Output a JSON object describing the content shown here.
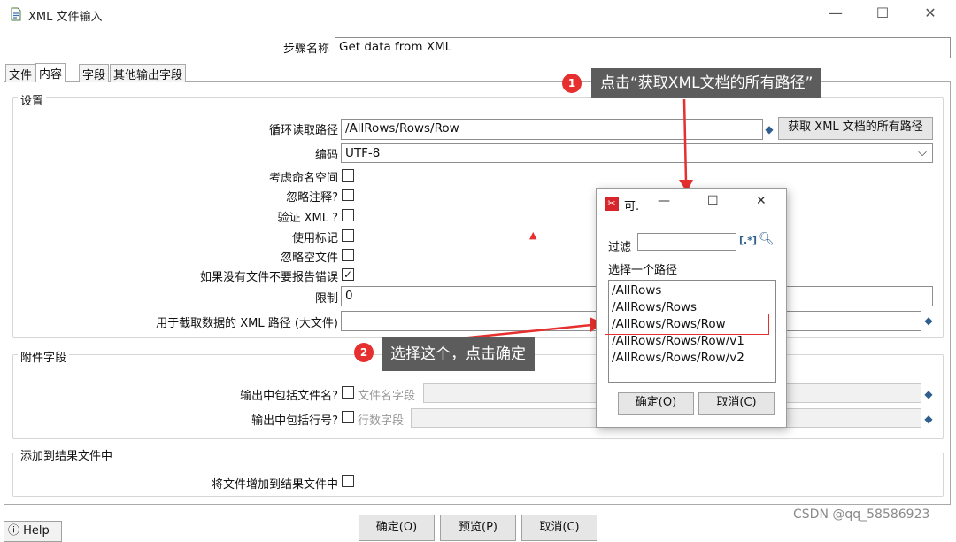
{
  "window": {
    "title": "XML 文件输入",
    "minimize": "—",
    "maximize": "☐",
    "close": "✕"
  },
  "step": {
    "label": "步骤名称",
    "value": "Get data from XML"
  },
  "tabs": [
    {
      "label": "文件"
    },
    {
      "label": "内容"
    },
    {
      "label": "字段"
    },
    {
      "label": "其他输出字段"
    }
  ],
  "settings": {
    "group_title": "设置",
    "loop_path_label": "循环读取路径",
    "loop_path_value": "/AllRows/Rows/Row",
    "get_paths_button": "获取 XML 文档的所有路径",
    "encoding_label": "编码",
    "encoding_value": "UTF-8",
    "namespace_label": "考虑命名空间",
    "ignore_comments_label": "忽略注释?",
    "validate_xml_label": "验证 XML ?",
    "use_token_label": "使用标记",
    "ignore_empty_label": "忽略空文件",
    "no_error_label": "如果没有文件不要报告错误",
    "limit_label": "限制",
    "limit_value": "0",
    "prune_path_label": "用于截取数据的 XML 路径 (大文件)",
    "prune_path_value": ""
  },
  "additional": {
    "group_title": "附件字段",
    "include_filename_label": "输出中包括文件名?",
    "filename_field_label": "文件名字段",
    "include_rownum_label": "输出中包括行号?",
    "rownum_field_label": "行数字段"
  },
  "result": {
    "group_title": "添加到结果文件中",
    "add_to_result_label": "将文件增加到结果文件中"
  },
  "bottom": {
    "ok": "确定(O)",
    "preview": "预览(P)",
    "cancel": "取消(C)",
    "help": "Help"
  },
  "dialog": {
    "title": "可.",
    "minimize": "—",
    "maximize": "☐",
    "close": "✕",
    "filter_label": "过滤",
    "filter_value": "",
    "regex_icon": "[.*]",
    "choose_label": "选择一个路径",
    "paths": [
      "/AllRows",
      "/AllRows/Rows",
      "/AllRows/Rows/Row",
      "/AllRows/Rows/Row/v1",
      "/AllRows/Rows/Row/v2"
    ],
    "ok": "确定(O)",
    "cancel": "取消(C)"
  },
  "annotations": {
    "badge1": "1",
    "callout1": "点击“获取XML文档的所有路径”",
    "badge2": "2",
    "callout2": "选择这个，点击确定",
    "accent_red": "#e5302f"
  },
  "watermark": "CSDN @qq_58586923"
}
